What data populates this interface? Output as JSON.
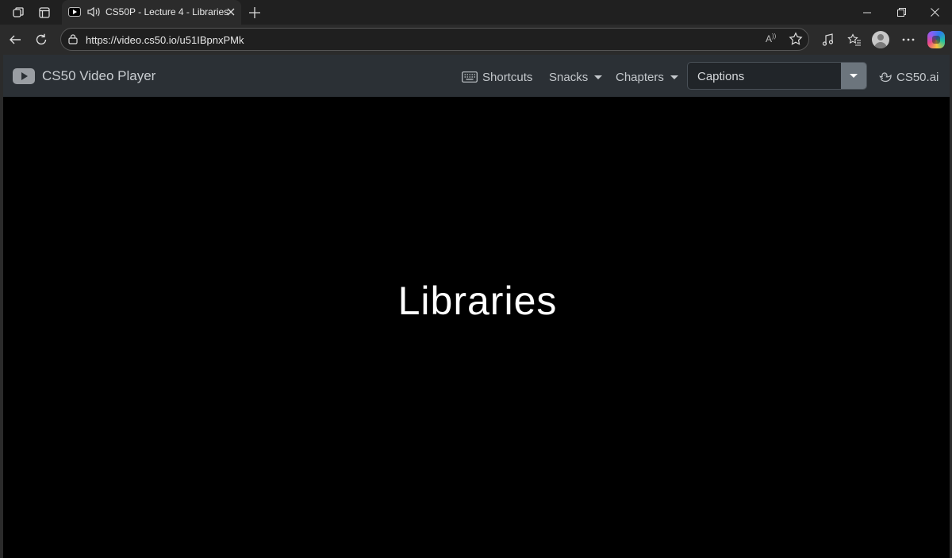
{
  "browser": {
    "tab": {
      "title": "CS50P - Lecture 4 - Libraries",
      "favicon": "youtube-icon",
      "audio_icon": "speaker-icon",
      "close_icon": "close-icon"
    },
    "new_tab_icon": "plus-icon",
    "address_bar": {
      "url": "https://video.cs50.io/u51IBpnxPMk",
      "read_aloud_label": "A",
      "favorite_icon": "star-icon"
    },
    "window_controls": [
      "minimize-icon",
      "restore-icon",
      "close-icon"
    ]
  },
  "app": {
    "brand": "CS50 Video Player",
    "nav": {
      "shortcuts": "Shortcuts",
      "snacks": "Snacks",
      "chapters": "Chapters",
      "captions_placeholder": "Captions",
      "cs50ai": "CS50.ai"
    },
    "colors": {
      "navbar_bg": "#2b3035",
      "captions_toggle_bg": "#6c757d",
      "video_bg": "#000000"
    }
  },
  "video": {
    "slide_title": "Libraries"
  }
}
